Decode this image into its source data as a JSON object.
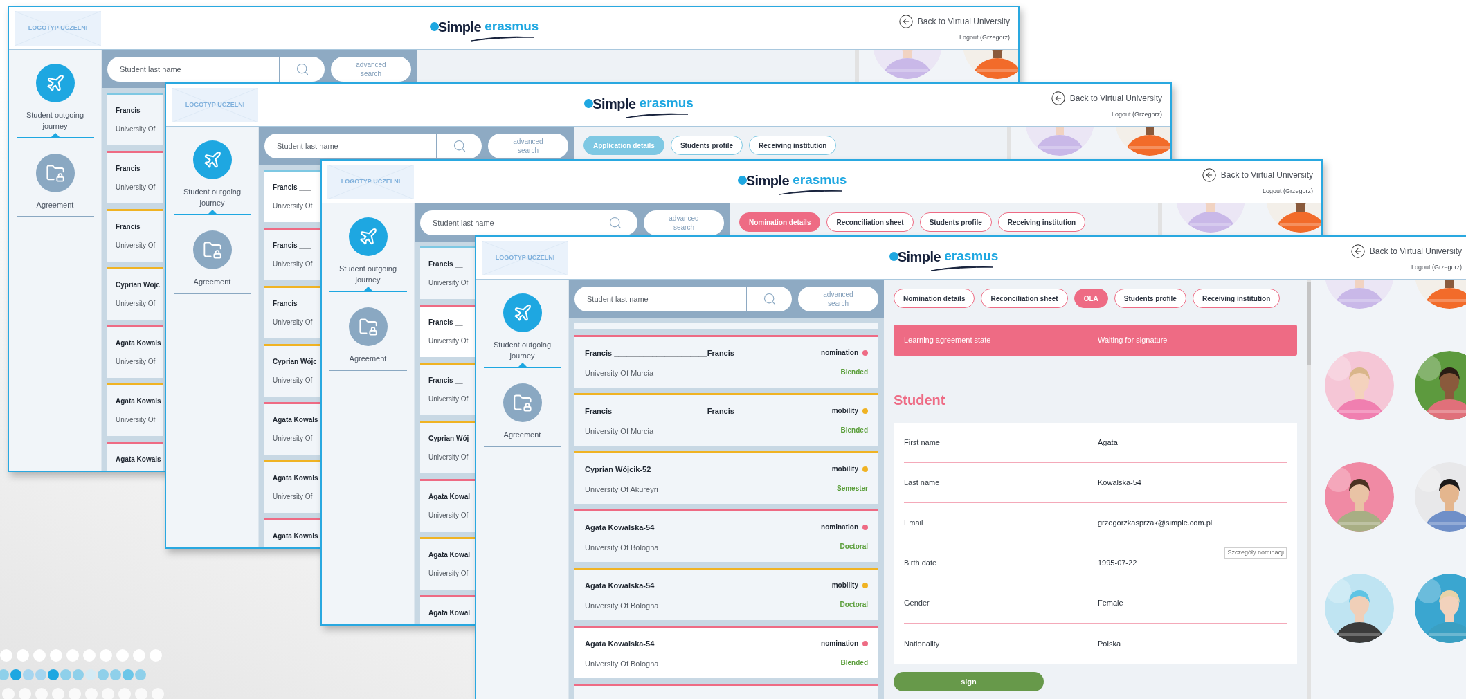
{
  "windows": [
    {
      "logo_placeholder": "LOGOTYP UCZELNI",
      "brand": {
        "name": "Simple",
        "accent": "erasmus"
      },
      "back_link": "Back to Virtual University",
      "logout": "Logout (Grzegorz)",
      "nav": [
        {
          "label": "Student outgoing journey",
          "selected": true
        },
        {
          "label": "Agreement",
          "selected": false
        }
      ],
      "search": {
        "placeholder": "Student last name",
        "advanced": "advanced search"
      },
      "cards": [
        {
          "name": "Francis ___",
          "university": "University Of",
          "color": "#7ec8e3",
          "selected": false
        },
        {
          "name": "Francis ___",
          "university": "University Of",
          "color": "#ee6b84",
          "selected": false
        },
        {
          "name": "Francis ___",
          "university": "University Of",
          "color": "#f0b323",
          "selected": false
        },
        {
          "name": "Cyprian Wójc",
          "university": "University Of",
          "color": "#f0b323",
          "selected": false
        },
        {
          "name": "Agata Kowals",
          "university": "University Of",
          "color": "#ee6b84",
          "selected": false
        },
        {
          "name": "Agata Kowals",
          "university": "University Of",
          "color": "#f0b323",
          "selected": false
        },
        {
          "name": "Agata Kowals",
          "color": "#ee6b84",
          "selected": false
        }
      ],
      "photos": [
        {
          "kind": "picture"
        },
        {
          "kind": "picture"
        }
      ]
    },
    {
      "logo_placeholder": "LOGOTYP UCZELNI",
      "brand": {
        "name": "Simple",
        "accent": "erasmus"
      },
      "back_link": "Back to Virtual University",
      "logout": "Logout (Grzegorz)",
      "color": "#7ec8e3",
      "nav": [
        {
          "label": "Student outgoing journey",
          "selected": true
        },
        {
          "label": "Agreement",
          "selected": false
        }
      ],
      "search": {
        "placeholder": "Student last name",
        "advanced": "advanced search"
      },
      "tabs": [
        {
          "label": "Application details",
          "selected": true
        },
        {
          "label": "Students profile",
          "selected": false
        },
        {
          "label": "Receiving institution",
          "selected": false
        }
      ],
      "cards": [
        {
          "name": "Francis ___",
          "university": "University Of",
          "color": "#7ec8e3",
          "selected": true
        },
        {
          "name": "Francis ___",
          "university": "University Of",
          "color": "#ee6b84",
          "selected": false
        },
        {
          "name": "Francis ___",
          "university": "University Of",
          "color": "#f0b323",
          "selected": false
        },
        {
          "name": "Cyprian Wójc",
          "university": "University Of",
          "color": "#f0b323",
          "selected": false
        },
        {
          "name": "Agata Kowals",
          "university": "University Of",
          "color": "#ee6b84",
          "selected": false
        },
        {
          "name": "Agata Kowals",
          "university": "University Of",
          "color": "#f0b323",
          "selected": false
        },
        {
          "name": "Agata Kowals",
          "color": "#ee6b84",
          "selected": false
        }
      ],
      "photos": [
        {
          "kind": "picture"
        },
        {
          "kind": "picture"
        }
      ]
    },
    {
      "logo_placeholder": "LOGOTYP UCZELNI",
      "brand": {
        "name": "Simple",
        "accent": "erasmus"
      },
      "back_link": "Back to Virtual University",
      "logout": "Logout (Grzegorz)",
      "color": "#ee6b84",
      "nav": [
        {
          "label": "Student outgoing journey",
          "selected": true
        },
        {
          "label": "Agreement",
          "selected": false
        }
      ],
      "search": {
        "placeholder": "Student last name",
        "advanced": "advanced search"
      },
      "tabs": [
        {
          "label": "Nomination details",
          "selected": true
        },
        {
          "label": "Reconciliation sheet",
          "selected": false
        },
        {
          "label": "Students profile",
          "selected": false
        },
        {
          "label": "Receiving institution",
          "selected": false
        }
      ],
      "cards": [
        {
          "name": "Francis __",
          "university": "University Of",
          "color": "#7ec8e3",
          "selected": false
        },
        {
          "name": "Francis __",
          "university": "University Of",
          "color": "#ee6b84",
          "selected": true
        },
        {
          "name": "Francis __",
          "university": "University Of",
          "color": "#f0b323",
          "selected": false
        },
        {
          "name": "Cyprian Wój",
          "university": "University Of",
          "color": "#f0b323",
          "selected": false
        },
        {
          "name": "Agata Kowal",
          "university": "University Of",
          "color": "#ee6b84",
          "selected": false
        },
        {
          "name": "Agata Kowal",
          "university": "University Of",
          "color": "#f0b323",
          "selected": false
        },
        {
          "name": "Agata Kowal",
          "color": "#ee6b84",
          "selected": false
        }
      ],
      "photos": [
        {
          "kind": "picture"
        },
        {
          "kind": "picture"
        }
      ]
    },
    {
      "logo_placeholder": "LOGOTYP UCZELNI",
      "brand": {
        "name": "Simple",
        "accent": "erasmus"
      },
      "back_link": "Back to Virtual University",
      "logout": "Logout (Grzegorz)",
      "color": "#ee6b84",
      "nav": [
        {
          "label": "Student outgoing journey",
          "selected": true
        },
        {
          "label": "Agreement",
          "selected": false
        }
      ],
      "search": {
        "placeholder": "Student last name",
        "advanced": "advanced search"
      },
      "tabs": [
        {
          "label": "Nomination details",
          "selected": false
        },
        {
          "label": "Reconciliation sheet",
          "selected": false
        },
        {
          "label": "OLA",
          "selected": true
        },
        {
          "label": "Students profile",
          "selected": false
        },
        {
          "label": "Receiving institution",
          "selected": false
        }
      ],
      "cards": [
        {
          "name": "Francis ______________________Francis",
          "university": "University Of Murcia",
          "type": "nomination",
          "color": "#ee6b84",
          "mode": "Blended",
          "selected": false
        },
        {
          "name": "Francis ______________________Francis",
          "university": "University Of Murcia",
          "type": "mobility",
          "color": "#f0b323",
          "mode": "Blended",
          "selected": false
        },
        {
          "name": "Cyprian Wójcik-52",
          "university": "University Of Akureyri",
          "type": "mobility",
          "color": "#f0b323",
          "mode": "Semester",
          "selected": false
        },
        {
          "name": "Agata Kowalska-54",
          "university": "University Of Bologna",
          "type": "nomination",
          "color": "#ee6b84",
          "mode": "Doctoral",
          "selected": false
        },
        {
          "name": "Agata Kowalska-54",
          "university": "University Of Bologna",
          "type": "mobility",
          "color": "#f0b323",
          "mode": "Doctoral",
          "selected": false
        },
        {
          "name": "Agata Kowalska-54",
          "university": "University Of Bologna",
          "type": "nomination",
          "color": "#ee6b84",
          "mode": "Blended",
          "selected": true
        }
      ],
      "detail": {
        "state_label": "Learning agreement state",
        "state_value": "Waiting for signature",
        "section": "Student",
        "fields": [
          {
            "label": "First name",
            "value": "Agata"
          },
          {
            "label": "Last name",
            "value": "Kowalska-54"
          },
          {
            "label": "Email",
            "value": "grzegorzkasprzak@simple.com.pl"
          },
          {
            "label": "Birth date",
            "value": "1995-07-22",
            "tooltip": "Szczegóły nominacji"
          },
          {
            "label": "Gender",
            "value": "Female"
          },
          {
            "label": "Nationality",
            "value": "Polska"
          }
        ],
        "button": "sign"
      },
      "photos": [
        {
          "kind": "picture"
        },
        {
          "kind": "picture"
        },
        {
          "kind": "picture"
        },
        {
          "kind": "picture"
        },
        {
          "kind": "picture"
        },
        {
          "kind": "picture"
        },
        {
          "kind": "picture"
        },
        {
          "kind": "picture"
        }
      ]
    }
  ]
}
